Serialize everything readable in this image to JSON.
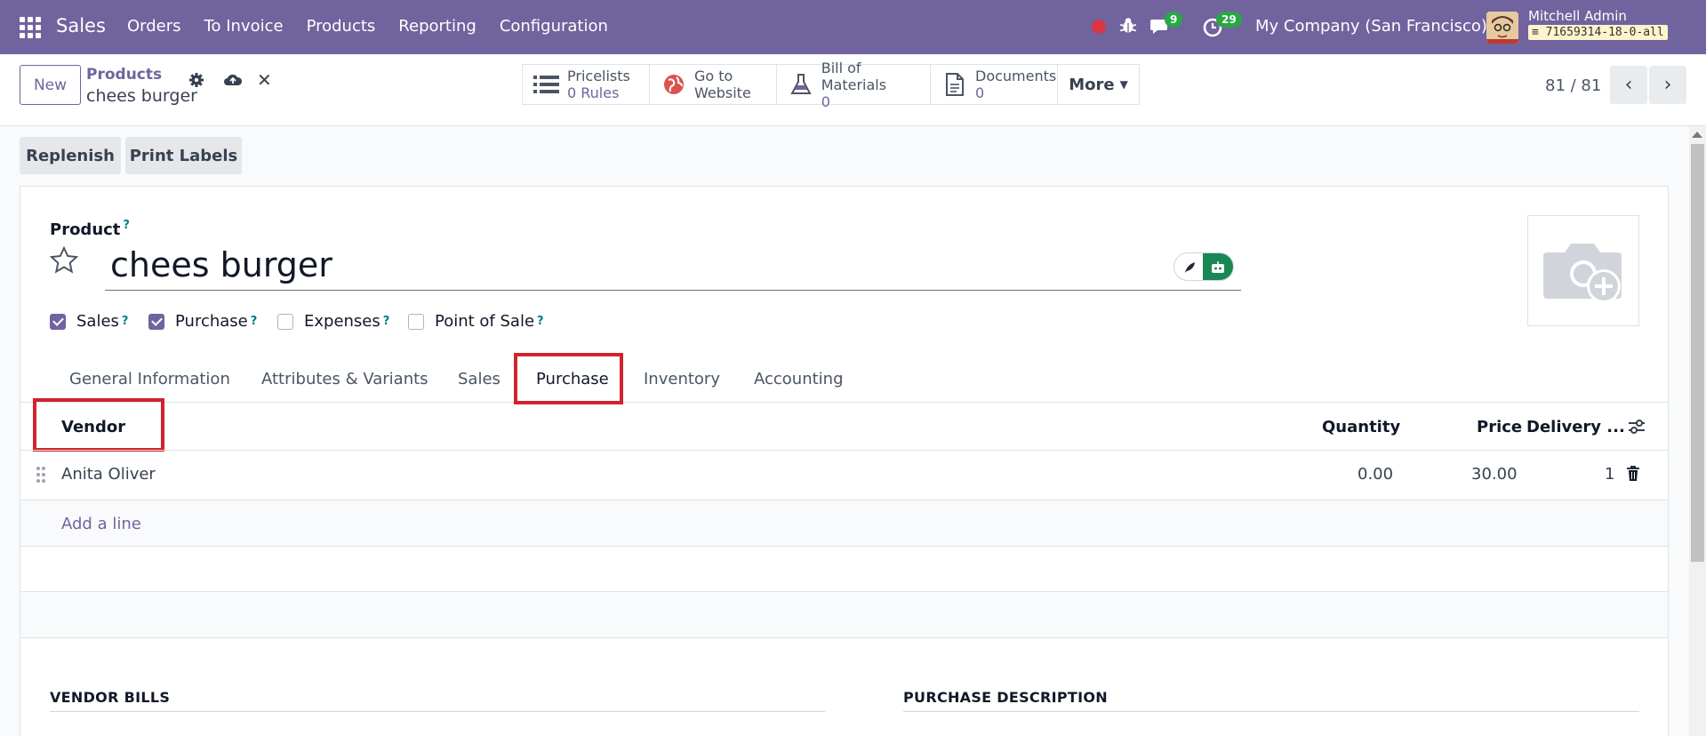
{
  "navbar": {
    "brand": "Sales",
    "menu": [
      "Orders",
      "To Invoice",
      "Products",
      "Reporting",
      "Configuration"
    ],
    "chat_badge": "9",
    "activity_badge": "29",
    "company": "My Company (San Francisco)",
    "user": "Mitchell Admin",
    "db": "71659314-18-0-all"
  },
  "control": {
    "new_label": "New",
    "breadcrumb": "Products",
    "record": "chees burger",
    "smart_buttons": [
      {
        "line1": "Pricelists",
        "line2": "0 Rules"
      },
      {
        "line1": "Go to",
        "line2": "Website"
      },
      {
        "line1": "Bill of Materials",
        "line2": "0"
      },
      {
        "line1": "Documents",
        "line2": "0"
      }
    ],
    "more_label": "More",
    "pager": "81 / 81"
  },
  "actions": {
    "replenish": "Replenish",
    "print_labels": "Print Labels"
  },
  "form": {
    "product_label": "Product",
    "help_mark": "?",
    "product_name": "chees burger",
    "checkboxes": [
      {
        "label": "Sales",
        "checked": true
      },
      {
        "label": "Purchase",
        "checked": true
      },
      {
        "label": "Expenses",
        "checked": false
      },
      {
        "label": "Point of Sale",
        "checked": false
      }
    ],
    "tabs": [
      "General Information",
      "Attributes & Variants",
      "Sales",
      "Purchase",
      "Inventory",
      "Accounting"
    ],
    "active_tab": "Purchase"
  },
  "vendor_table": {
    "headers": {
      "vendor": "Vendor",
      "quantity": "Quantity",
      "price": "Price",
      "delivery": "Delivery ..."
    },
    "rows": [
      {
        "vendor": "Anita Oliver",
        "quantity": "0.00",
        "price": "30.00",
        "delivery": "1"
      }
    ],
    "add_line": "Add a line"
  },
  "sections": {
    "vendor_bills": "VENDOR BILLS",
    "purchase_description": "PURCHASE DESCRIPTION"
  },
  "colors": {
    "brand": "#71639e",
    "highlight": "#d0242d",
    "badge": "#28a745"
  }
}
